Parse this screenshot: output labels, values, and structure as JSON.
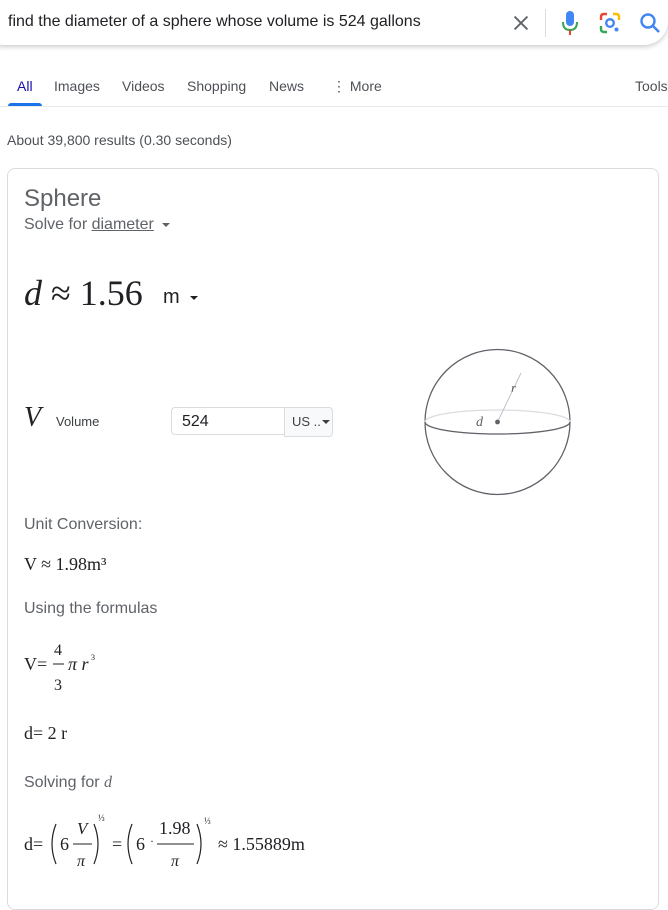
{
  "search": {
    "query": "find the diameter of a sphere whose volume is 524 gallons"
  },
  "tabs": [
    {
      "label": "All"
    },
    {
      "label": "Images"
    },
    {
      "label": "Videos"
    },
    {
      "label": "Shopping"
    },
    {
      "label": "News"
    },
    {
      "label": "More"
    }
  ],
  "tools_label": "Tools",
  "result_stats": "About 39,800 results (0.30 seconds)",
  "calculator": {
    "title": "Sphere",
    "solve_for_prefix": "Solve for",
    "solve_for_value": "diameter",
    "result_var": "d",
    "result_approx": "≈",
    "result_value": "1.56",
    "result_unit": "m",
    "volume_symbol": "V",
    "volume_label": "Volume",
    "volume_value": "524",
    "volume_unit": "US ..",
    "diagram_r": "r",
    "diagram_d": "d",
    "unit_conversion_label": "Unit Conversion:",
    "unit_conversion_value": "V ≈ 1.98m³",
    "formulas_label": "Using the formulas",
    "formula_volume": {
      "lhs": "V=",
      "num": "4",
      "den": "3",
      "rest": "π r",
      "exp": "3"
    },
    "formula_diameter": "d= 2 r",
    "solving_label": "Solving for",
    "solving_var": "d",
    "solution": {
      "lhs": "d=",
      "six": "6",
      "V": "V",
      "pi": "π",
      "exp": "⅓",
      "eq": "=",
      "val": "1.98",
      "result": "≈ 1.55889m"
    }
  },
  "colors": {
    "accent": "#1a73e8",
    "link": "#1a0dab"
  },
  "icons": [
    "clear-icon",
    "microphone-icon",
    "google-lens-icon",
    "search-icon",
    "more-dots-icon"
  ]
}
